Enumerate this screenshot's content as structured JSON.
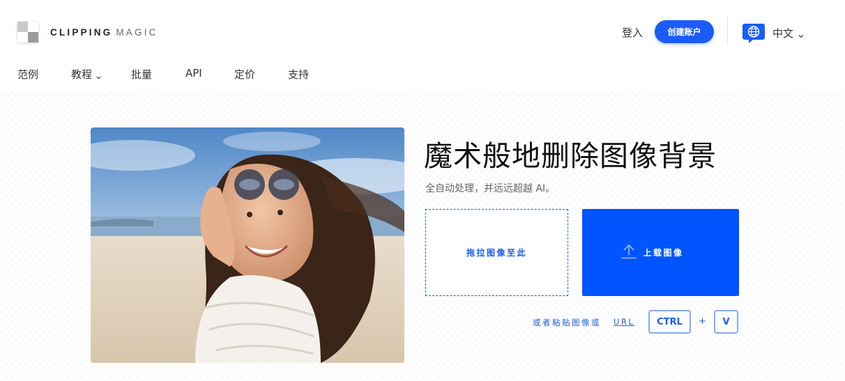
{
  "brand": {
    "word1": "CLIPPING",
    "word2": "MAGIC"
  },
  "header": {
    "login_label": "登入",
    "signup_label": "创建账户",
    "language_label": "中文"
  },
  "nav": {
    "items": [
      {
        "label": "范例"
      },
      {
        "label": "教程"
      },
      {
        "label": "批量"
      },
      {
        "label": "API"
      },
      {
        "label": "定价"
      },
      {
        "label": "支持"
      }
    ]
  },
  "hero": {
    "headline": "魔术般地删除图像背景",
    "subline": "全自动处理，并远远超越 AI。",
    "dropzone_label": "拖拉图像至此",
    "upload_label": "上载图像",
    "paste_text": "或者粘贴图像或",
    "paste_url": "URL",
    "key_ctrl": "CTRL",
    "key_plus": "+",
    "key_v": "V"
  },
  "colors": {
    "accent": "#1a5cf5",
    "upload_bg": "#0055ff",
    "text": "#333333"
  },
  "icons": {
    "logo": "checker-logo-icon",
    "globe": "globe-chat-icon",
    "chevron": "chevron-down-icon",
    "upload": "upload-arrow-icon"
  }
}
